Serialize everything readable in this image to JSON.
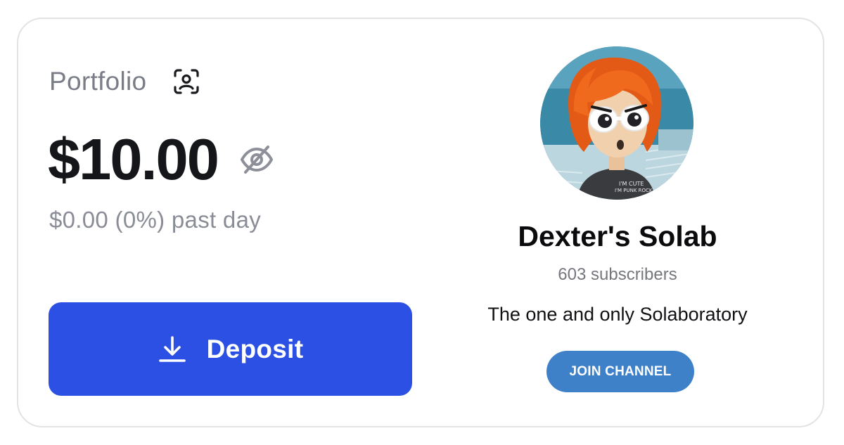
{
  "portfolio": {
    "label": "Portfolio",
    "balance": "$10.00",
    "change": "$0.00 (0%) past day",
    "deposit_label": "Deposit",
    "icons": [
      "face-id-icon",
      "eye-off-icon",
      "download-icon"
    ]
  },
  "channel": {
    "name": "Dexter's Solab",
    "subscribers": "603 subscribers",
    "description": "The one and only Solaboratory",
    "join_label": "JOIN CHANNEL",
    "avatar_icon": "avatar-cartoon-red-hair",
    "avatar_shirt_text": "I'M CUTE I'M PUNK ROCK"
  },
  "colors": {
    "deposit_button": "#2b50e3",
    "join_button": "#3f81c9",
    "muted_text": "#7a7d87",
    "card_border": "#e3e3e6"
  }
}
